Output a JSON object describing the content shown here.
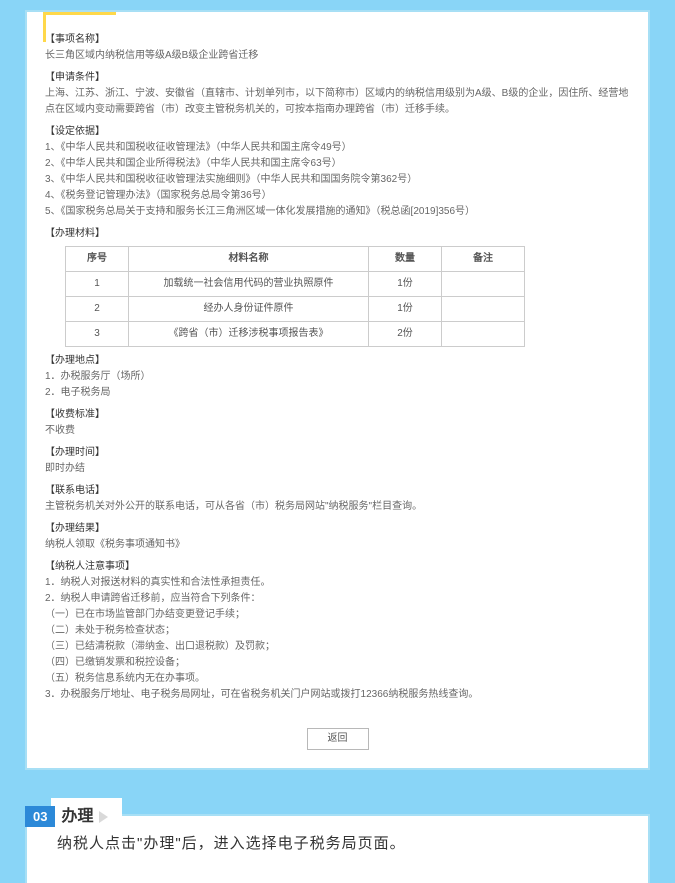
{
  "sections": {
    "item_name": {
      "heading": "事项名称",
      "body": "长三角区域内纳税信用等级A级B级企业跨省迁移"
    },
    "apply_cond": {
      "heading": "申请条件",
      "body": "上海、江苏、浙江、宁波、安徽省（直辖市、计划单列市，以下简称市）区域内的纳税信用级别为A级、B级的企业，因住所、经营地点在区域内变动需要跨省（市）改变主管税务机关的，可按本指南办理跨省（市）迁移手续。"
    },
    "basis": {
      "heading": "设定依据",
      "items": [
        "1、《中华人民共和国税收征收管理法》（中华人民共和国主席令49号）",
        "2、《中华人民共和国企业所得税法》（中华人民共和国主席令63号）",
        "3、《中华人民共和国税收征收管理法实施细则》（中华人民共和国国务院令第362号）",
        "4、《税务登记管理办法》（国家税务总局令第36号）",
        "5、《国家税务总局关于支持和服务长江三角洲区域一体化发展措施的通知》（税总函[2019]356号）"
      ]
    },
    "materials": {
      "heading": "办理材料",
      "table_headers": [
        "序号",
        "材料名称",
        "数量",
        "备注"
      ],
      "rows": [
        [
          "1",
          "加载统一社会信用代码的营业执照原件",
          "1份",
          ""
        ],
        [
          "2",
          "经办人身份证件原件",
          "1份",
          ""
        ],
        [
          "3",
          "《跨省（市）迁移涉税事项报告表》",
          "2份",
          ""
        ]
      ]
    },
    "place": {
      "heading": "办理地点",
      "body1": "1．办税服务厅（场所）",
      "body2": "2．电子税务局"
    },
    "fee": {
      "heading": "收费标准",
      "body": "不收费"
    },
    "time": {
      "heading": "办理时间",
      "body": "即时办结"
    },
    "phone": {
      "heading": "联系电话",
      "body": "主管税务机关对外公开的联系电话，可从各省（市）税务局网站\"纳税服务\"栏目查询。"
    },
    "result": {
      "heading": "办理结果",
      "body": "纳税人领取《税务事项通知书》"
    },
    "notes": {
      "heading": "纳税人注意事项",
      "items": [
        "1．纳税人对报送材料的真实性和合法性承担责任。",
        "2．纳税人申请跨省迁移前，应当符合下列条件：",
        "（一）已在市场监管部门办结变更登记手续；",
        "（二）未处于税务检查状态；",
        "（三）已结清税款（滞纳金、出口退税款）及罚款；",
        "（四）已缴销发票和税控设备；",
        "（五）税务信息系统内无在办事项。",
        "3．办税服务厅地址、电子税务局网址，可在省税务机关门户网站或拨打12366纳税服务热线查询。"
      ]
    }
  },
  "back_btn": "返回",
  "step": {
    "num": "03",
    "title": "办理",
    "desc": "纳税人点击\"办理\"后，进入选择电子税务局页面。"
  }
}
